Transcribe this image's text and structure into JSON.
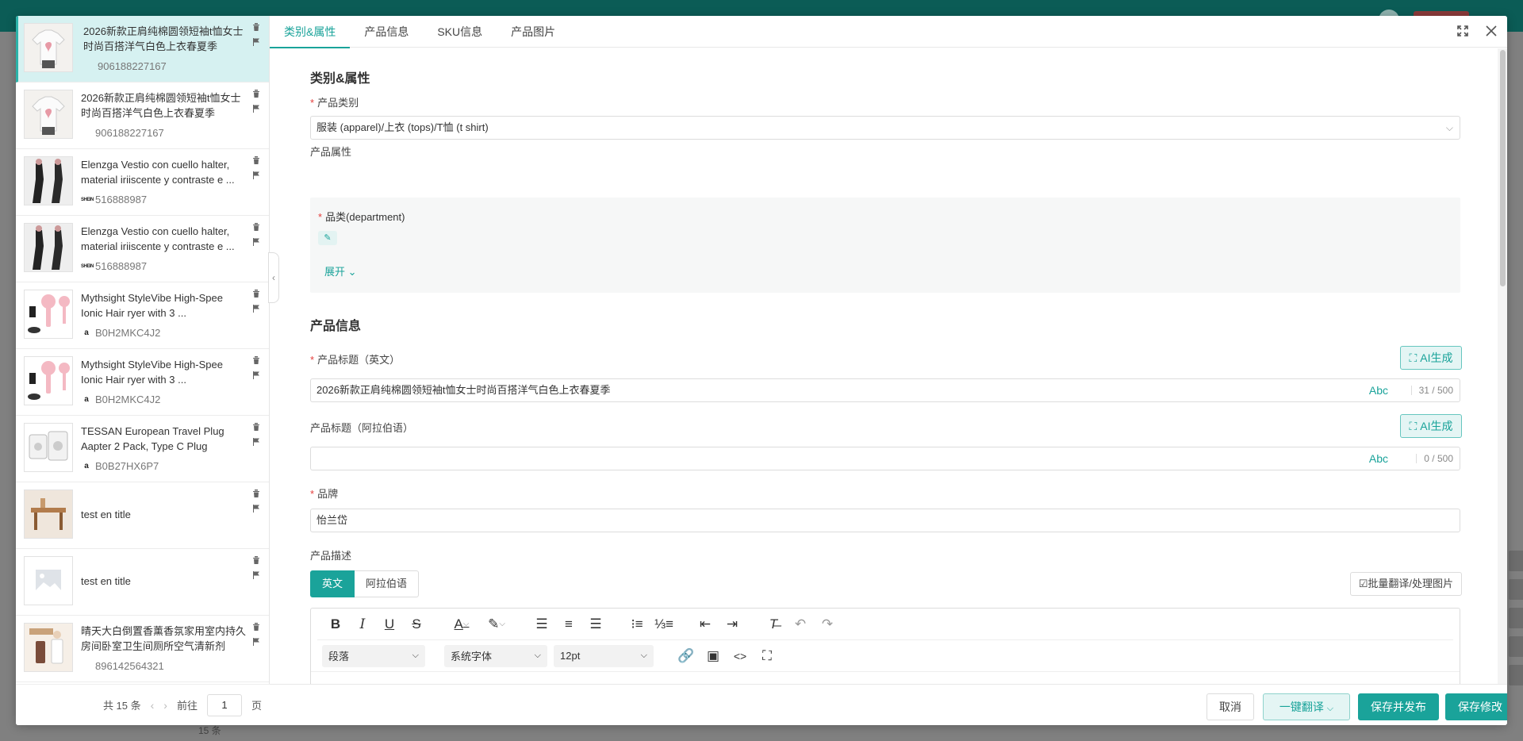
{
  "background": {
    "footer_text": "15 条"
  },
  "products": [
    {
      "title": "2026新款正肩纯棉圆领短袖t恤女士时尚百搭洋气白色上衣春夏季",
      "id": "906188227167",
      "platform": "",
      "thumb": "shirt",
      "active": true
    },
    {
      "title": "2026新款正肩纯棉圆领短袖t恤女士时尚百搭洋气白色上衣春夏季",
      "id": "906188227167",
      "platform": "",
      "thumb": "shirt",
      "active": false
    },
    {
      "title": "Elenzga Vestio con cuello halter, material iriiscente y contraste e ...",
      "id": "516888987",
      "platform": "SHEIN",
      "thumb": "dress",
      "active": false
    },
    {
      "title": "Elenzga Vestio con cuello halter, material iriiscente y contraste e ...",
      "id": "516888987",
      "platform": "SHEIN",
      "thumb": "dress",
      "active": false
    },
    {
      "title": "Mythsight StyleVibe High-Spee Ionic Hair ryer with 3 ...",
      "id": "B0H2MKC4J2",
      "platform": "a",
      "thumb": "dryer",
      "active": false
    },
    {
      "title": "Mythsight StyleVibe High-Spee Ionic Hair ryer with 3 ...",
      "id": "B0H2MKC4J2",
      "platform": "a",
      "thumb": "dryer",
      "active": false
    },
    {
      "title": "TESSAN European Travel Plug Aapter 2 Pack, Type C Plug",
      "id": "B0B27HX6P7",
      "platform": "a",
      "thumb": "plug",
      "active": false
    },
    {
      "title": "test en title",
      "id": "",
      "platform": "",
      "thumb": "table",
      "active": false
    },
    {
      "title": "test en title",
      "id": "",
      "platform": "",
      "thumb": "placeholder",
      "active": false
    },
    {
      "title": "晴天大白倒置香薰香氛家用室内持久房间卧室卫生间厕所空气清新剂",
      "id": "896142564321",
      "platform": "",
      "thumb": "aroma",
      "active": false
    }
  ],
  "pager": {
    "total": "共 15 条",
    "prev": "‹",
    "next": "›",
    "goto_label": "前往",
    "page": "1",
    "page_suffix": "页"
  },
  "tabs": [
    "类别&属性",
    "产品信息",
    "SKU信息",
    "产品图片"
  ],
  "category_section": {
    "title": "类别&属性",
    "category_label": "产品类别",
    "category_value": "服装 (apparel)/上衣 (tops)/T恤 (t shirt)",
    "attr_label": "产品属性",
    "department_label": "品类(department)",
    "expand": "展开"
  },
  "info_section": {
    "title": "产品信息",
    "title_en_label": "产品标题（英文）",
    "title_en_value": "2026新款正肩纯棉圆领短袖t恤女士时尚百搭洋气白色上衣春夏季",
    "title_en_count": "31 / 500",
    "title_ar_label": "产品标题（阿拉伯语）",
    "title_ar_value": "",
    "title_ar_count": "0 / 500",
    "abc": "Abc",
    "ai_label": "AI生成",
    "brand_label": "品牌",
    "brand_value": "怡兰岱",
    "desc_label": "产品描述",
    "lang_en": "英文",
    "lang_ar": "阿拉伯语",
    "batch_label": "批量翻译/处理图片"
  },
  "editor": {
    "block": "段落",
    "font": "系统字体",
    "size": "12pt"
  },
  "footer": {
    "cancel": "取消",
    "translate": "一键翻译",
    "publish": "保存并发布",
    "save": "保存修改"
  },
  "colors": {
    "accent": "#1aa39a",
    "required": "#e5403e",
    "active_row": "#d6f1f1"
  }
}
